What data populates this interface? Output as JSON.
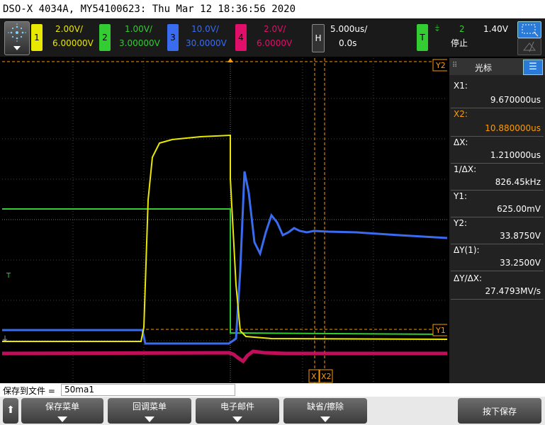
{
  "window_title": "DSO-X 4034A, MY54100623: Thu Mar 12 18:36:56 2020",
  "channels": [
    {
      "num": "1",
      "scale": "2.00V/",
      "offset": "6.00000V",
      "color": "#e8e800"
    },
    {
      "num": "2",
      "scale": "1.00V/",
      "offset": "3.00000V",
      "color": "#33cc33"
    },
    {
      "num": "3",
      "scale": "10.0V/",
      "offset": "30.0000V",
      "color": "#3a6cf0"
    },
    {
      "num": "4",
      "scale": "2.0V/",
      "offset": "6.0000V",
      "color": "#e0106a"
    }
  ],
  "horizontal": {
    "key": "H",
    "scale": "5.000us/",
    "delay": "0.0s"
  },
  "trigger": {
    "key": "T",
    "source": "2",
    "level": "1.40V",
    "status": "停止"
  },
  "screen_markers": {
    "y2": "Y2",
    "y1": "Y1",
    "x1": "X",
    "x2": "X2",
    "trig": "T"
  },
  "cursor_panel": {
    "title": "光标",
    "rows": [
      {
        "label": "X1:",
        "value": "9.670000us",
        "color": "#ffffff"
      },
      {
        "label": "X2:",
        "value": "10.880000us",
        "color": "#ff9a00"
      },
      {
        "label": "ΔX:",
        "value": "1.210000us",
        "color": "#ffffff"
      },
      {
        "label": "1/ΔX:",
        "value": "826.45kHz",
        "color": "#ffffff"
      },
      {
        "label": "Y1:",
        "value": "625.00mV",
        "color": "#ffffff"
      },
      {
        "label": "Y2:",
        "value": "33.8750V",
        "color": "#ffffff"
      },
      {
        "label": "ΔY(1):",
        "value": "33.2500V",
        "color": "#ffffff"
      },
      {
        "label": "ΔY/ΔX:",
        "value": "27.4793MV/s",
        "color": "#ffffff"
      }
    ]
  },
  "file_bar": {
    "label": "保存到文件 =",
    "value": "50ma1"
  },
  "softkeys": [
    "保存菜单",
    "回调菜单",
    "电子邮件",
    "缺省/擦除",
    "按下保存"
  ]
}
